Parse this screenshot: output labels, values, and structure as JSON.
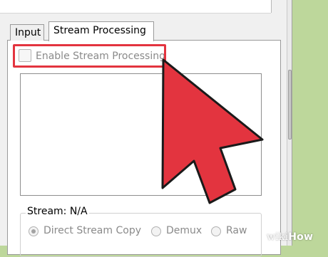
{
  "tabs": [
    {
      "label": "Input",
      "active": false
    },
    {
      "label": "Stream Processing",
      "active": true
    }
  ],
  "enable_checkbox": {
    "label": "Enable Stream Processing",
    "checked": false,
    "enabled": false
  },
  "stream_group": {
    "title": "Stream: N/A",
    "options": [
      {
        "label": "Direct Stream Copy",
        "selected": true
      },
      {
        "label": "Demux",
        "selected": false
      },
      {
        "label": "Raw",
        "selected": false
      }
    ]
  },
  "watermark": {
    "wiki": "wiki",
    "how": "How"
  },
  "colors": {
    "highlight": "#e3343f",
    "arrow": "#e3343f",
    "background": "#bdd79b"
  }
}
